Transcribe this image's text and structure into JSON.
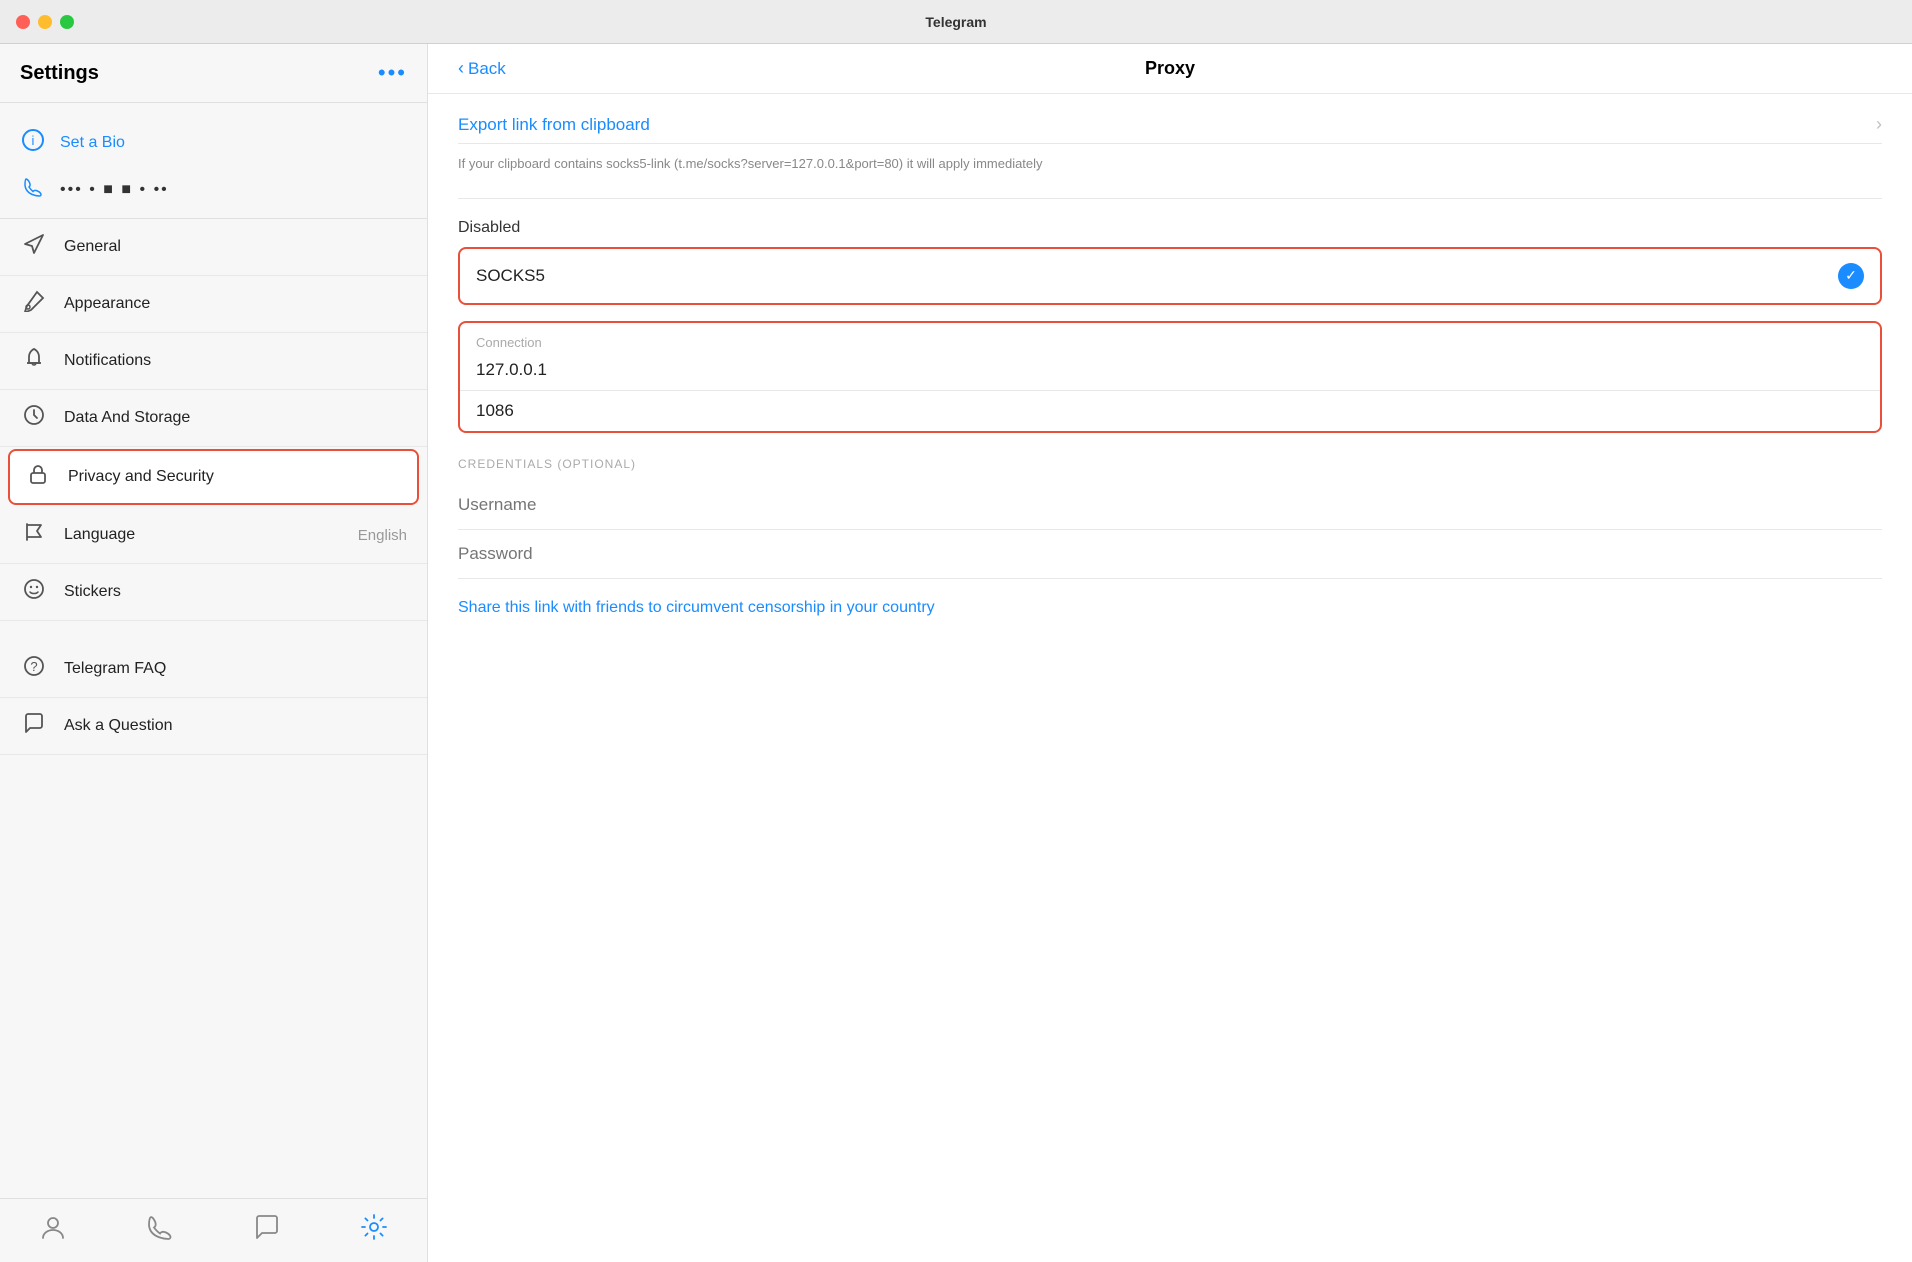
{
  "titleBar": {
    "title": "Telegram"
  },
  "sidebar": {
    "title": "Settings",
    "dotsLabel": "•••",
    "profile": {
      "setBio": "Set a Bio",
      "phone": "•••  • ■ ■ •  ••"
    },
    "navItems": [
      {
        "id": "general",
        "label": "General",
        "value": "",
        "active": false,
        "icon": "send-icon"
      },
      {
        "id": "appearance",
        "label": "Appearance",
        "value": "",
        "active": false,
        "icon": "brush-icon"
      },
      {
        "id": "notifications",
        "label": "Notifications",
        "value": "",
        "active": false,
        "icon": "bell-icon"
      },
      {
        "id": "data-storage",
        "label": "Data And Storage",
        "value": "",
        "active": false,
        "icon": "clock-icon"
      },
      {
        "id": "privacy-security",
        "label": "Privacy and Security",
        "value": "",
        "active": true,
        "icon": "lock-icon"
      },
      {
        "id": "language",
        "label": "Language",
        "value": "English",
        "active": false,
        "icon": "flag-icon"
      },
      {
        "id": "stickers",
        "label": "Stickers",
        "value": "",
        "active": false,
        "icon": "sticker-icon"
      }
    ],
    "supportItems": [
      {
        "id": "faq",
        "label": "Telegram FAQ",
        "icon": "question-icon"
      },
      {
        "id": "ask",
        "label": "Ask a Question",
        "icon": "chat-icon"
      }
    ],
    "bottomNav": [
      {
        "id": "contacts",
        "icon": "person-icon",
        "active": false
      },
      {
        "id": "calls",
        "icon": "phone-icon",
        "active": false
      },
      {
        "id": "chats",
        "icon": "chat-bottom-icon",
        "active": false
      },
      {
        "id": "settings",
        "icon": "gear-icon",
        "active": true
      }
    ]
  },
  "proxy": {
    "backLabel": "Back",
    "title": "Proxy",
    "exportLink": {
      "label": "Export link from clipboard",
      "description": "If your clipboard contains socks5-link (t.me/socks?server=127.0.0.1&port=80) it will apply immediately"
    },
    "disabled": "Disabled",
    "socks5": "SOCKS5",
    "connection": {
      "header": "Connection",
      "ip": "127.0.0.1",
      "port": "1086"
    },
    "credentials": {
      "label": "CREDENTIALS (OPTIONAL)",
      "usernamePlaceholder": "Username",
      "passwordPlaceholder": "Password"
    },
    "shareLink": "Share this link with friends to circumvent censorship in your country"
  }
}
